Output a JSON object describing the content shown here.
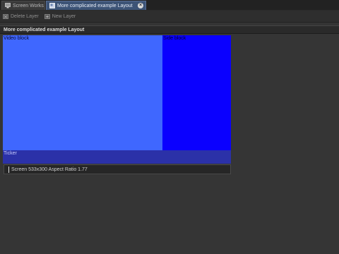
{
  "tabs": [
    {
      "label": "Screen Works",
      "icon": "monitor-icon",
      "active": false
    },
    {
      "label": "More complicated example Layout",
      "icon": "layout-icon",
      "active": true,
      "closable": true
    }
  ],
  "toolbar": {
    "delete_label": "Delete Layer",
    "new_label": "New Layer"
  },
  "panel": {
    "title": "More complicated example Layout"
  },
  "layout_blocks": {
    "video": {
      "label": "Video block",
      "color": "#3f67ff"
    },
    "side": {
      "label": "Side block",
      "color": "#0a00ff"
    },
    "ticker": {
      "label": "Ticker",
      "color": "#2b31a8"
    }
  },
  "status": {
    "text": "Screen 533x300 Aspect Ratio 1.77"
  }
}
